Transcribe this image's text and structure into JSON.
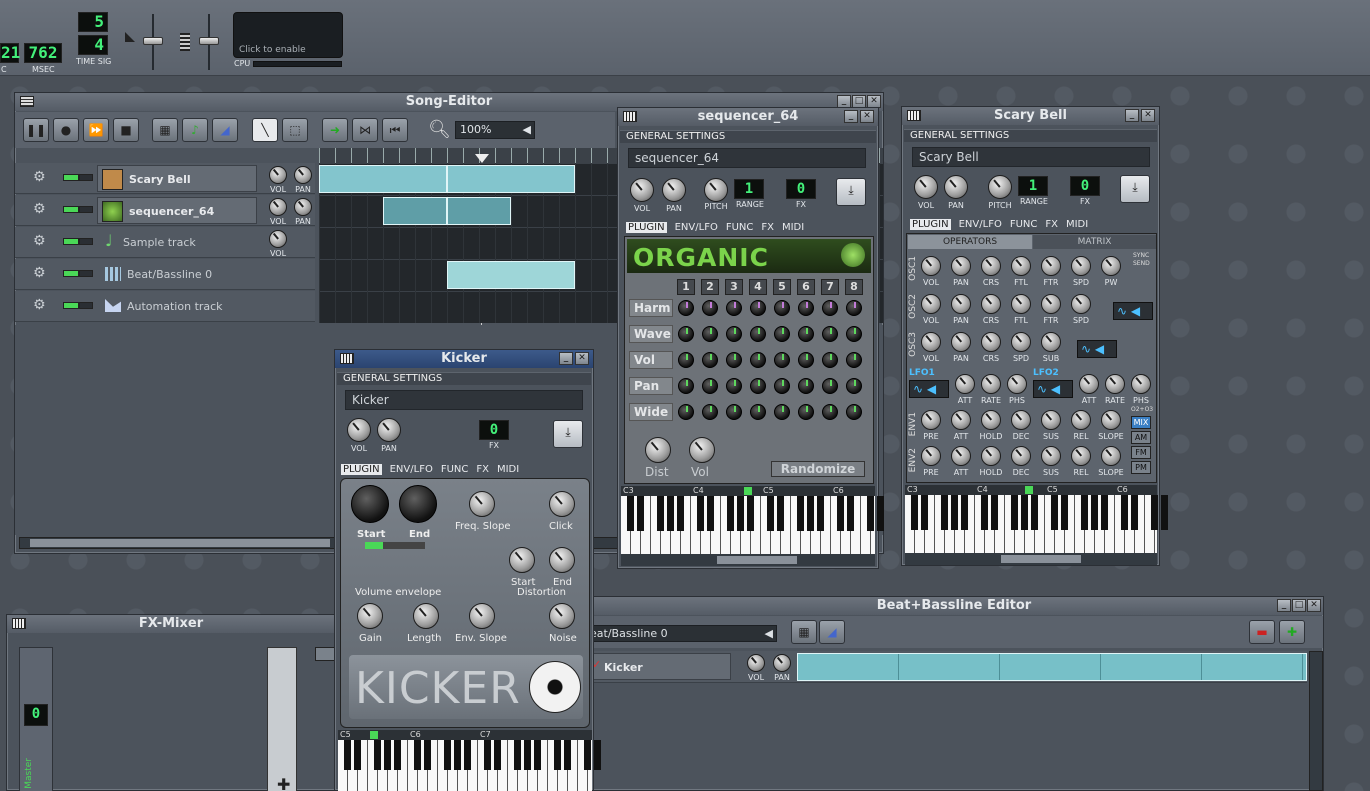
{
  "toolbar": {
    "time_left": "21",
    "time_msec": "762",
    "label_sec": "C",
    "label_msec": "MSEC",
    "timesig_top": "5",
    "timesig_bottom": "4",
    "label_timesig": "TIME SIG",
    "cpu_click": "Click to enable",
    "label_cpu": "CPU"
  },
  "song_editor": {
    "title": "Song-Editor",
    "zoom": "100%",
    "tracks": [
      {
        "name": "Scary Bell",
        "type": "instrument"
      },
      {
        "name": "sequencer_64",
        "type": "instrument"
      },
      {
        "name": "Sample track",
        "type": "sample"
      },
      {
        "name": "Beat/Bassline 0",
        "type": "beat"
      },
      {
        "name": "Automation track",
        "type": "automation"
      }
    ],
    "vol": "VOL",
    "pan": "PAN"
  },
  "sequencer": {
    "title": "sequencer_64",
    "general": "GENERAL SETTINGS",
    "name": "sequencer_64",
    "vol": "VOL",
    "pan": "PAN",
    "pitch": "PITCH",
    "range": "RANGE",
    "fx": "FX",
    "range_val": "1",
    "fx_val": "0",
    "tabs": [
      "PLUGIN",
      "ENV/LFO",
      "FUNC",
      "FX",
      "MIDI"
    ],
    "logo": "ORGANIC",
    "cols": [
      "1",
      "2",
      "3",
      "4",
      "5",
      "6",
      "7",
      "8"
    ],
    "rows": [
      "Harm",
      "Wave",
      "Vol",
      "Pan",
      "Wide"
    ],
    "dist": "Dist",
    "vol2": "Vol",
    "randomize": "Randomize",
    "octaves": [
      "C3",
      "C4",
      "C5",
      "C6"
    ]
  },
  "scary": {
    "title": "Scary Bell",
    "general": "GENERAL SETTINGS",
    "name": "Scary Bell",
    "vol": "VOL",
    "pan": "PAN",
    "pitch": "PITCH",
    "range": "RANGE",
    "fx": "FX",
    "range_val": "1",
    "fx_val": "0",
    "tabs": [
      "PLUGIN",
      "ENV/LFO",
      "FUNC",
      "FX",
      "MIDI"
    ],
    "subtabs": [
      "OPERATORS",
      "MATRIX"
    ],
    "osc1": [
      "VOL",
      "PAN",
      "CRS",
      "FTL",
      "FTR",
      "SPD",
      "PW"
    ],
    "osc2": [
      "VOL",
      "PAN",
      "CRS",
      "FTL",
      "FTR",
      "SPD"
    ],
    "osc3": [
      "VOL",
      "PAN",
      "CRS",
      "SPD",
      "SUB"
    ],
    "lfo1": "LFO1",
    "lfo2": "LFO2",
    "lfo_knobs": [
      "ATT",
      "RATE",
      "PHS"
    ],
    "env": [
      "PRE",
      "ATT",
      "HOLD",
      "DEC",
      "SUS",
      "REL",
      "SLOPE"
    ],
    "osc_labels": [
      "OSC1",
      "OSC2",
      "OSC3"
    ],
    "env_labels": [
      "ENV1",
      "ENV2"
    ],
    "sync": "SYNC",
    "send": "SEND",
    "mix_label": "O2+O3",
    "mix": [
      "MIX",
      "AM",
      "FM",
      "PM"
    ],
    "octaves": [
      "C3",
      "C4",
      "C5",
      "C6"
    ]
  },
  "kicker": {
    "title": "Kicker",
    "general": "GENERAL SETTINGS",
    "name": "Kicker",
    "vol": "VOL",
    "pan": "PAN",
    "fx": "FX",
    "fx_val": "0",
    "tabs": [
      "PLUGIN",
      "ENV/LFO",
      "FUNC",
      "FX",
      "MIDI"
    ],
    "start": "Start",
    "end": "End",
    "freq_slope": "Freq. Slope",
    "click": "Click",
    "start_dist": "Start",
    "end_dist": "End",
    "distortion": "Distortion",
    "vol_env": "Volume envelope",
    "gain": "Gain",
    "length": "Length",
    "env_slope": "Env. Slope",
    "noise": "Noise",
    "logo": "KICKER",
    "octaves": [
      "C5",
      "C6",
      "C7"
    ]
  },
  "fx_mixer": {
    "title": "FX-Mixer",
    "master": "Master",
    "fx_val": "0"
  },
  "beat_editor": {
    "title": "Beat+Bassline Editor",
    "selector": "eat/Bassline 0",
    "track": "Kicker",
    "vol": "VOL",
    "pan": "PAN"
  }
}
